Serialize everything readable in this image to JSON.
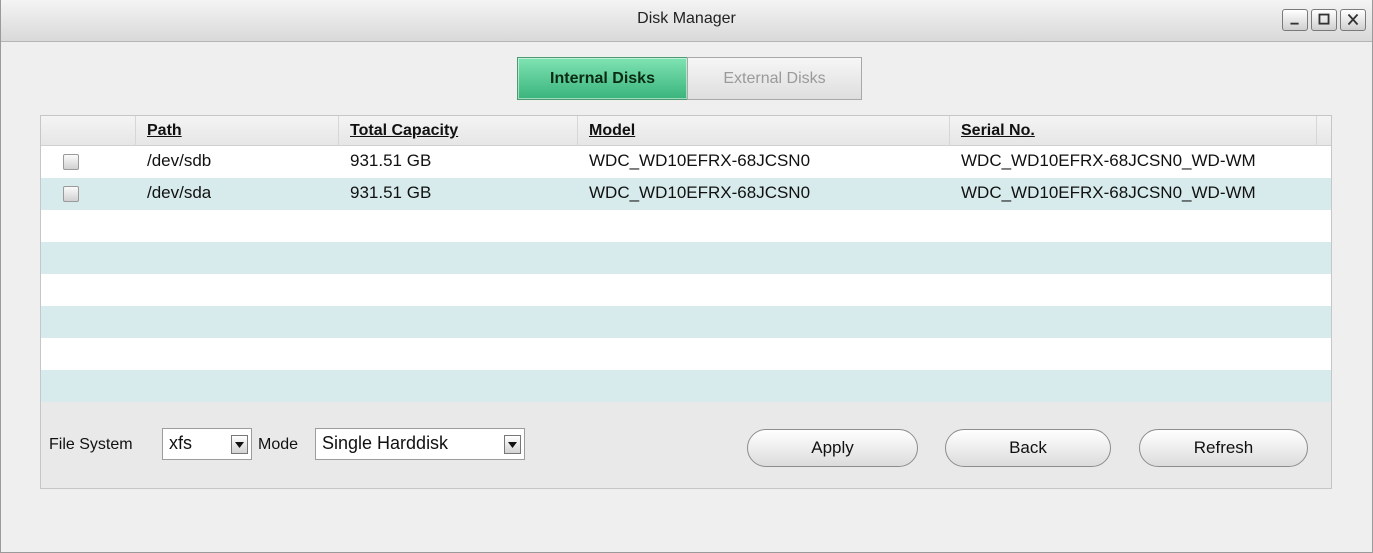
{
  "window": {
    "title": "Disk Manager"
  },
  "tabs": [
    {
      "label": "Internal Disks",
      "active": true
    },
    {
      "label": "External Disks",
      "active": false
    }
  ],
  "table": {
    "columns": [
      "Path",
      "Total Capacity",
      "Model",
      "Serial No."
    ],
    "rows": [
      {
        "checked": false,
        "path": "/dev/sdb",
        "capacity": "931.51 GB",
        "model": "WDC_WD10EFRX-68JCSN0",
        "serial": "WDC_WD10EFRX-68JCSN0_WD-WM"
      },
      {
        "checked": false,
        "path": "/dev/sda",
        "capacity": "931.51 GB",
        "model": "WDC_WD10EFRX-68JCSN0",
        "serial": "WDC_WD10EFRX-68JCSN0_WD-WM"
      }
    ]
  },
  "footer": {
    "filesystem_label": "File System",
    "filesystem_value": "xfs",
    "mode_label": "Mode",
    "mode_value": "Single Harddisk",
    "apply_label": "Apply",
    "back_label": "Back",
    "refresh_label": "Refresh"
  },
  "colors": {
    "active_tab": "#3ab47c",
    "row_alt": "#d7ebed"
  }
}
